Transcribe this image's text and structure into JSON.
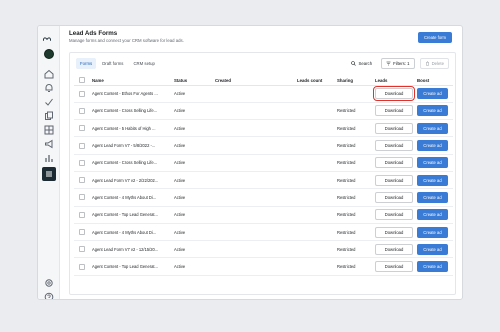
{
  "header": {
    "title": "Lead Ads Forms",
    "subtitle": "Manage forms and connect your CRM software for lead ads.",
    "create_form_label": "Create form"
  },
  "tabs": [
    {
      "label": "Forms",
      "active": true
    },
    {
      "label": "Draft forms",
      "active": false
    },
    {
      "label": "CRM setup",
      "active": false
    }
  ],
  "toolbar": {
    "search_label": "Search",
    "filters_label": "Filters: 1",
    "delete_label": "Delete"
  },
  "table": {
    "columns": [
      "Name",
      "Status",
      "Created",
      "Leads count",
      "Sharing",
      "Leads",
      "Boost"
    ],
    "rows": [
      {
        "name": "Agent Content - Ethos For Agents ...",
        "status": "Active",
        "created": "",
        "leads_count": "",
        "sharing": "",
        "download": "Download",
        "boost": "Create ad"
      },
      {
        "name": "Agent Content - Cross Selling Life...",
        "status": "Active",
        "created": "",
        "leads_count": "",
        "sharing": "Restricted",
        "download": "Download",
        "boost": "Create ad"
      },
      {
        "name": "Agent Content - 5 Habits of High ...",
        "status": "Active",
        "created": "",
        "leads_count": "",
        "sharing": "Restricted",
        "download": "Download",
        "boost": "Create ad"
      },
      {
        "name": "Agent Lead Form V7 - 5/8/2022 -...",
        "status": "Active",
        "created": "",
        "leads_count": "",
        "sharing": "Restricted",
        "download": "Download",
        "boost": "Create ad"
      },
      {
        "name": "Agent Content - Cross Selling Life...",
        "status": "Active",
        "created": "",
        "leads_count": "",
        "sharing": "Restricted",
        "download": "Download",
        "boost": "Create ad"
      },
      {
        "name": "Agent Lead Form V7 v2 - 2/22/202...",
        "status": "Active",
        "created": "",
        "leads_count": "",
        "sharing": "Restricted",
        "download": "Download",
        "boost": "Create ad"
      },
      {
        "name": "Agent Content - 4 Myths About Di...",
        "status": "Active",
        "created": "",
        "leads_count": "",
        "sharing": "Restricted",
        "download": "Download",
        "boost": "Create ad"
      },
      {
        "name": "Agent Content - Top Lead Generat...",
        "status": "Active",
        "created": "",
        "leads_count": "",
        "sharing": "Restricted",
        "download": "Download",
        "boost": "Create ad"
      },
      {
        "name": "Agent Content - 4 Myths About Di...",
        "status": "Active",
        "created": "",
        "leads_count": "",
        "sharing": "Restricted",
        "download": "Download",
        "boost": "Create ad"
      },
      {
        "name": "Agent Lead Form V7 v2 - 12/15/20...",
        "status": "Active",
        "created": "",
        "leads_count": "",
        "sharing": "Restricted",
        "download": "Download",
        "boost": "Create ad"
      },
      {
        "name": "Agent Content - Top Lead Generat...",
        "status": "Active",
        "created": "",
        "leads_count": "",
        "sharing": "Restricted",
        "download": "Download",
        "boost": "Create ad"
      }
    ]
  },
  "colors": {
    "primary": "#3a7bd5",
    "highlight": "#e0322b",
    "rail_active": "#1c2b33"
  },
  "icons": [
    "meta-logo",
    "account-avatar",
    "home-icon",
    "notification-icon",
    "check-icon",
    "pages-icon",
    "grid-icon",
    "megaphone-icon",
    "chart-icon",
    "menu-icon",
    "settings-icon",
    "help-icon",
    "search-icon",
    "filter-icon",
    "trash-icon"
  ]
}
